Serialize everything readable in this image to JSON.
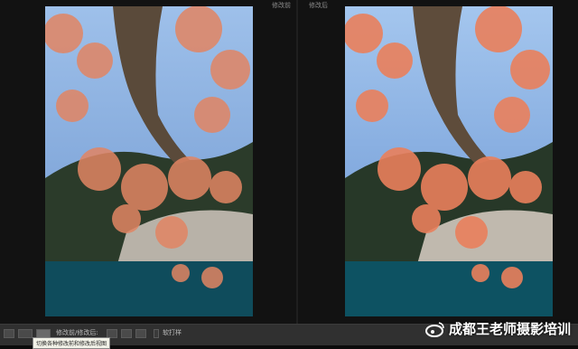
{
  "compare": {
    "before_label": "修改前",
    "after_label": "修改后"
  },
  "photo": {
    "subject": "autumn tree branches over lake",
    "colors": {
      "sky": "#7aa3d8",
      "leaves": "#e28563",
      "water": "#0f4c5c",
      "hills": "#2a3a2a",
      "trunk": "#5a4a3a"
    }
  },
  "toolbar": {
    "view_label": "修改前/修改后:",
    "proof_label": "软打样",
    "tooltip": "切换各种修改前和修改后视图"
  },
  "watermark": {
    "icon": "weibo-logo",
    "text": "成都王老师摄影培训"
  }
}
